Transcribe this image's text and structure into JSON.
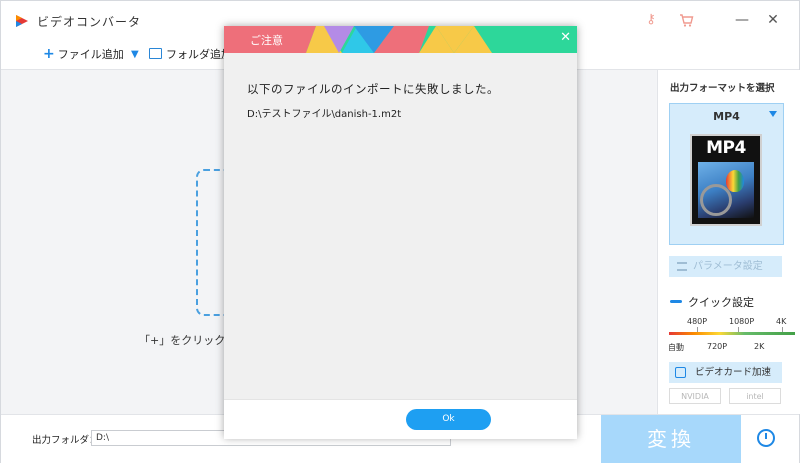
{
  "app": {
    "title": "ビデオコンバータ"
  },
  "toolbar": {
    "add_file": "ファイル追加",
    "add_folder": "フォルダ追加"
  },
  "main": {
    "hint": "「+」をクリックして"
  },
  "right": {
    "format_title": "出力フォーマットを選択",
    "format_name": "MP4",
    "format_image_text": "MP4",
    "param_label": "パラメータ設定",
    "quick_title": "クイック設定",
    "res_top": [
      "480P",
      "1080P",
      "4K"
    ],
    "res_bottom": [
      "自動",
      "720P",
      "2K"
    ],
    "gpu_label": "ビデオカード加速",
    "gpu_chips": [
      "NVIDIA",
      "intel"
    ]
  },
  "bottom": {
    "output_label": "出力フォルダ：",
    "output_path": "D:\\",
    "convert_label": "変換"
  },
  "dialog": {
    "title": "ご注意",
    "message": "以下のファイルのインポートに失敗しました。",
    "path": "D:\\テストファイル\\danish-1.m2t",
    "ok_label": "Ok"
  },
  "colors": {
    "accent": "#1e9ff2",
    "header_green": "#2dd79a",
    "convert_disabled": "#a7d8fb"
  }
}
